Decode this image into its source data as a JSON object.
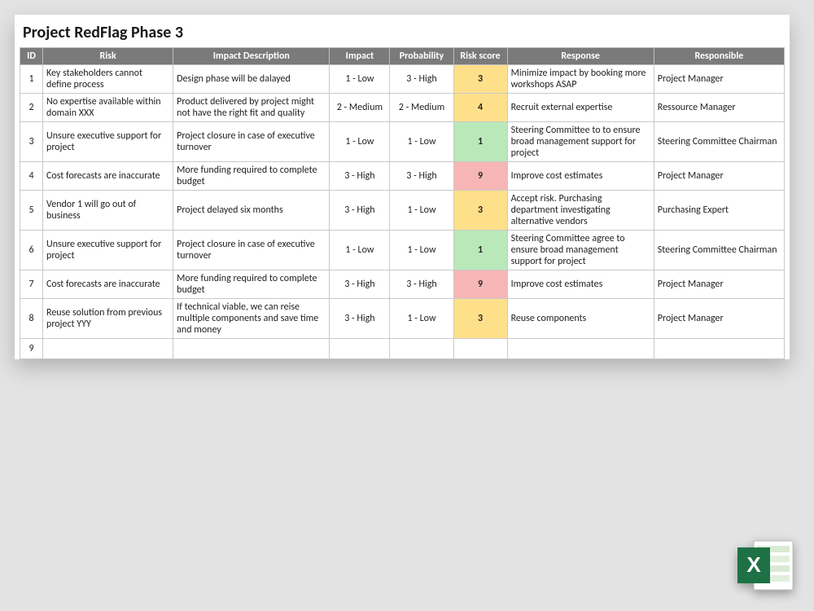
{
  "title": "Project RedFlag Phase 3",
  "columns": [
    "ID",
    "Risk",
    "Impact Description",
    "Impact",
    "Probability",
    "Risk score",
    "Response",
    "Responsible"
  ],
  "score_colors": {
    "low": {
      "class": "score-green",
      "hex": "#b9e8b9"
    },
    "medium": {
      "class": "score-yellow",
      "hex": "#ffe08a"
    },
    "high": {
      "class": "score-red",
      "hex": "#f6b6b6"
    }
  },
  "rows": [
    {
      "id": "1",
      "risk": "Key stakeholders cannot define process",
      "impact_desc": "Design phase will be dalayed",
      "impact": "1 - Low",
      "probability": "3 - High",
      "score": "3",
      "score_level": "medium",
      "response": "Minimize impact by booking more workshops ASAP",
      "responsible": "Project Manager"
    },
    {
      "id": "2",
      "risk": "No expertise available within domain XXX",
      "impact_desc": "Product delivered by project might not have the right fit and quality",
      "impact": "2 - Medium",
      "probability": "2 - Medium",
      "score": "4",
      "score_level": "medium",
      "response": "Recruit external expertise",
      "responsible": "Ressource Manager"
    },
    {
      "id": "3",
      "risk": "Unsure executive support for project",
      "impact_desc": "Project closure in case of executive turnover",
      "impact": "1 - Low",
      "probability": "1 - Low",
      "score": "1",
      "score_level": "low",
      "response": "Steering Committee to to ensure broad management support for project",
      "responsible": "Steering Committee Chairman"
    },
    {
      "id": "4",
      "risk": "Cost forecasts are inaccurate",
      "impact_desc": "More funding required to complete budget",
      "impact": "3 - High",
      "probability": "3 - High",
      "score": "9",
      "score_level": "high",
      "response": "Improve cost estimates",
      "responsible": "Project Manager"
    },
    {
      "id": "5",
      "risk": "Vendor 1 will go out of business",
      "impact_desc": "Project delayed six months",
      "impact": "3 - High",
      "probability": "1 - Low",
      "score": "3",
      "score_level": "medium",
      "response": "Accept risk. Purchasing department investigating alternative vendors",
      "responsible": "Purchasing Expert"
    },
    {
      "id": "6",
      "risk": "Unsure executive support for project",
      "impact_desc": "Project closure in case of executive turnover",
      "impact": "1 - Low",
      "probability": "1 - Low",
      "score": "1",
      "score_level": "low",
      "response": "Steering Committee agree to ensure broad management support for project",
      "responsible": "Steering Committee Chairman"
    },
    {
      "id": "7",
      "risk": "Cost forecasts are inaccurate",
      "impact_desc": "More funding required to complete budget",
      "impact": "3 - High",
      "probability": "3 - High",
      "score": "9",
      "score_level": "high",
      "response": "Improve cost estimates",
      "responsible": "Project Manager"
    },
    {
      "id": "8",
      "risk": "Reuse solution from previous project YYY",
      "impact_desc": "If technical viable, we can reise multiple components and save time and money",
      "impact": "3 - High",
      "probability": "1 - Low",
      "score": "3",
      "score_level": "medium",
      "response": "Reuse components",
      "responsible": "Project Manager"
    },
    {
      "id": "9",
      "risk": "",
      "impact_desc": "",
      "impact": "",
      "probability": "",
      "score": "",
      "score_level": "",
      "response": "",
      "responsible": ""
    }
  ],
  "icon": {
    "name": "excel-file-icon",
    "letter": "X",
    "brand_hex": "#1e7145"
  }
}
